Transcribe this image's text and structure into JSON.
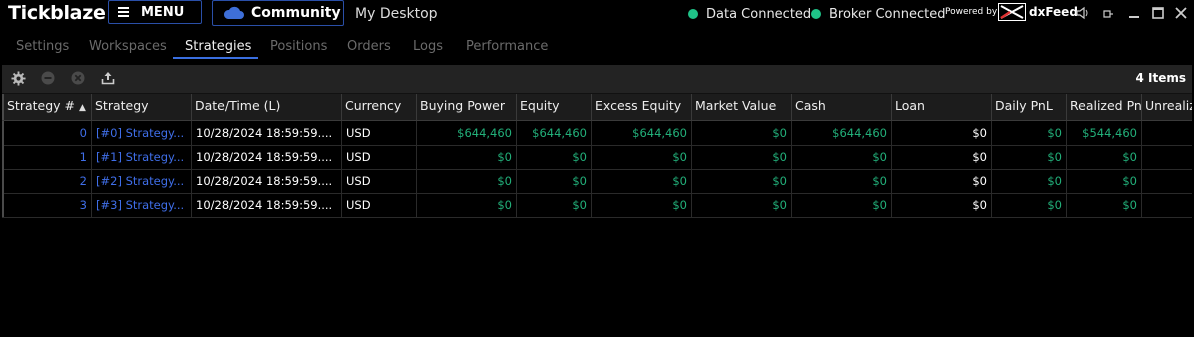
{
  "app": {
    "brand": "Tickblaze",
    "menu_label": "MENU",
    "community_label": "Community",
    "desktop_label": "My Desktop"
  },
  "status": {
    "data": "Data Connected",
    "broker": "Broker Connected",
    "powered_by": "Powered by",
    "provider": "dxFeed",
    "dot_color": "#1fc388"
  },
  "tabs": [
    {
      "label": "Settings",
      "active": false
    },
    {
      "label": "Workspaces",
      "active": false
    },
    {
      "label": "Strategies",
      "active": true
    },
    {
      "label": "Positions",
      "active": false
    },
    {
      "label": "Orders",
      "active": false
    },
    {
      "label": "Logs",
      "active": false
    },
    {
      "label": "Performance",
      "active": false
    }
  ],
  "toolbar": {
    "items_count": "4 Items",
    "icons": [
      "gear-icon",
      "remove-icon",
      "cancel-icon",
      "export-icon"
    ]
  },
  "grid": {
    "columns": [
      "Strategy #",
      "Strategy",
      "Date/Time (L)",
      "Currency",
      "Buying Power",
      "Equity",
      "Excess Equity",
      "Market Value",
      "Cash",
      "Loan",
      "Daily PnL",
      "Realized PnL",
      "Unrealiz"
    ],
    "sort_indicator": "▲",
    "rows": [
      [
        "0",
        "[#0] Strategy...",
        "10/28/2024 18:59:59....",
        "USD",
        "$644,460",
        "$644,460",
        "$644,460",
        "$0",
        "$644,460",
        "$0",
        "$0",
        "$544,460",
        ""
      ],
      [
        "1",
        "[#1] Strategy...",
        "10/28/2024 18:59:59....",
        "USD",
        "$0",
        "$0",
        "$0",
        "$0",
        "$0",
        "$0",
        "$0",
        "$0",
        ""
      ],
      [
        "2",
        "[#2] Strategy...",
        "10/28/2024 18:59:59....",
        "USD",
        "$0",
        "$0",
        "$0",
        "$0",
        "$0",
        "$0",
        "$0",
        "$0",
        ""
      ],
      [
        "3",
        "[#3] Strategy...",
        "10/28/2024 18:59:59....",
        "USD",
        "$0",
        "$0",
        "$0",
        "$0",
        "$0",
        "$0",
        "$0",
        "$0",
        ""
      ]
    ]
  },
  "colors": {
    "accent": "#3a6fe0",
    "link": "#3f6ee8",
    "money": "#22b07a"
  }
}
